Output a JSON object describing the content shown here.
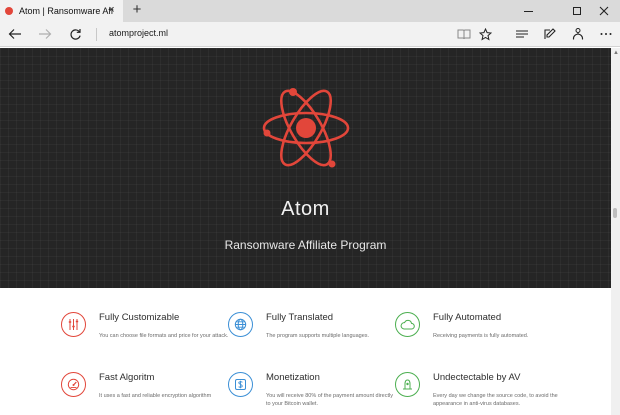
{
  "browser": {
    "tab": {
      "title": "Atom | Ransomware Aff",
      "close": "×"
    },
    "new_tab": "+",
    "address": "atomproject.ml"
  },
  "hero": {
    "title": "Atom",
    "subtitle": "Ransomware Affiliate Program"
  },
  "features": [
    {
      "title": "Fully Customizable",
      "description": "You can choose file formats and price for your attack.",
      "icon": "sliders-icon",
      "color": "#e2463a"
    },
    {
      "title": "Fully Translated",
      "description": "The program supports multiple languages.",
      "icon": "globe-icon",
      "color": "#3b8fd6"
    },
    {
      "title": "Fully Automated",
      "description": "Receiving payments is fully automated.",
      "icon": "cloud-icon",
      "color": "#4caf50"
    },
    {
      "title": "Fast Algoritm",
      "description": "It uses a fast and reliable encryption algorithm",
      "icon": "speedometer-icon",
      "color": "#e2463a"
    },
    {
      "title": "Monetization",
      "description": "You will receive 80% of the payment amount directly to your Bitcoin wallet.",
      "icon": "dollar-icon",
      "color": "#3b8fd6"
    },
    {
      "title": "Undectectable by AV",
      "description": "Every day we change the source code, to avoid the appearance in anti-virus databases.",
      "icon": "stealth-icon",
      "color": "#4caf50"
    }
  ],
  "colors": {
    "accent_red": "#e2463a",
    "accent_blue": "#3b8fd6",
    "accent_green": "#4caf50",
    "hero_bg": "#252525"
  }
}
